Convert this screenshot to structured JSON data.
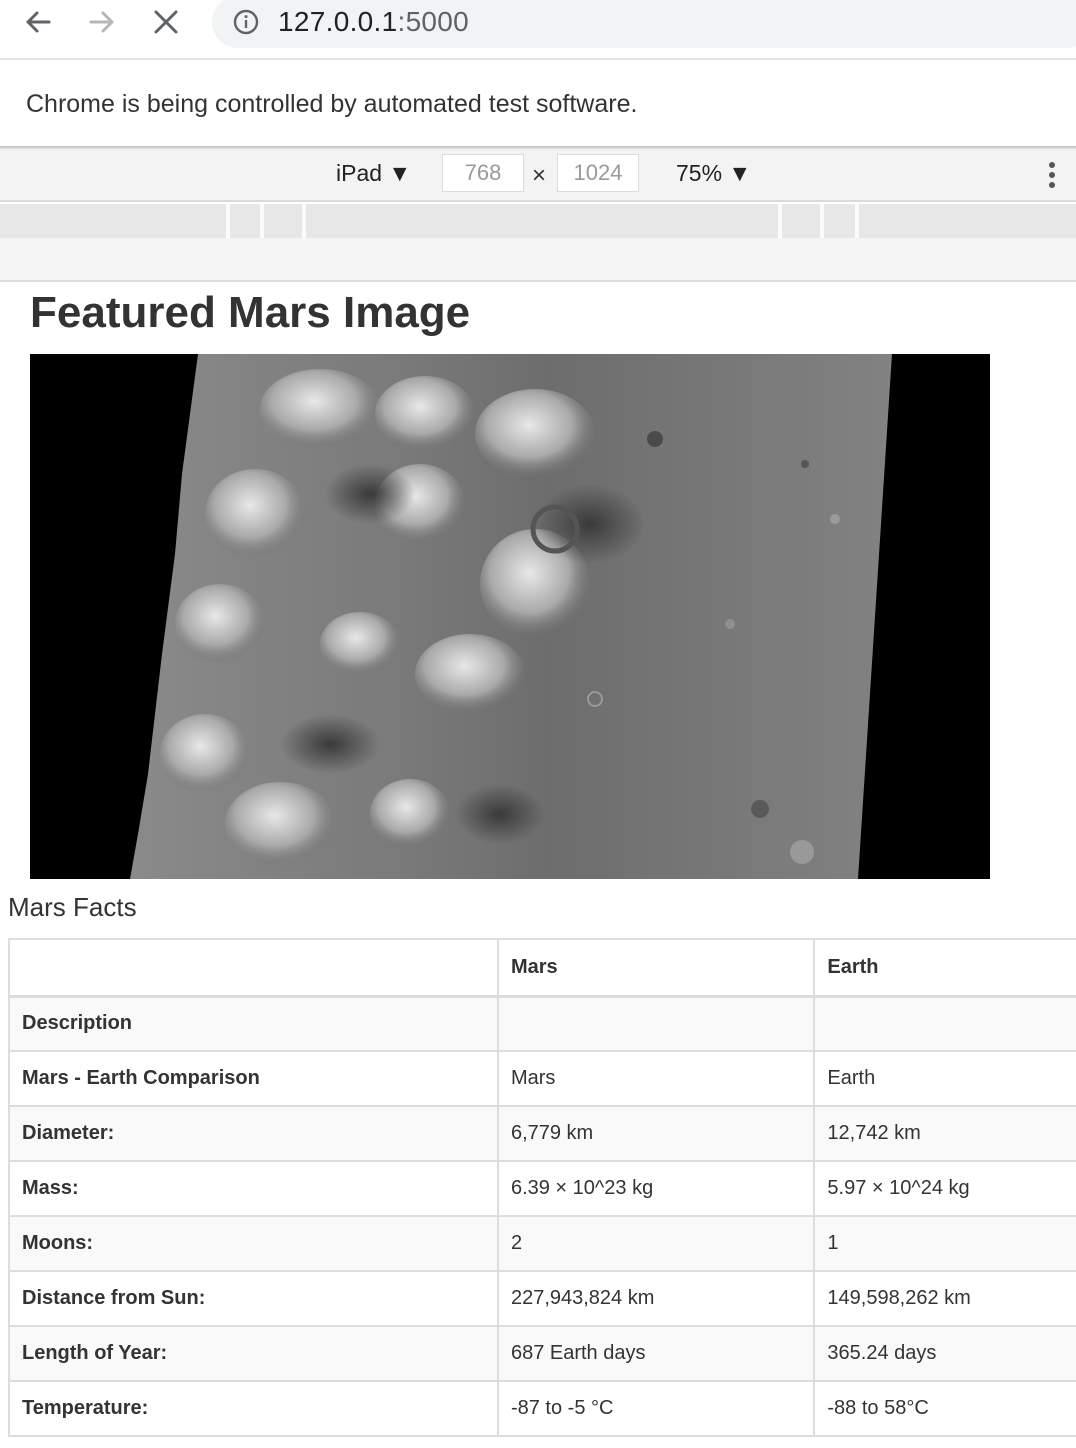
{
  "browser": {
    "url_host": "127.0.0.1",
    "url_port": ":5000",
    "infobar_text": "Chrome is being controlled by automated test software."
  },
  "device_toolbar": {
    "device": "iPad ▼",
    "width": "768",
    "times": "×",
    "height": "1024",
    "zoom": "75% ▼"
  },
  "page": {
    "title": "Featured Mars Image",
    "facts_title": "Mars Facts",
    "table": {
      "headers": [
        "",
        "Mars",
        "Earth"
      ],
      "rows": [
        [
          "Description",
          "",
          ""
        ],
        [
          "Mars - Earth Comparison",
          "Mars",
          "Earth"
        ],
        [
          "Diameter:",
          "6,779 km",
          "12,742 km"
        ],
        [
          "Mass:",
          "6.39 × 10^23 kg",
          "5.97 × 10^24 kg"
        ],
        [
          "Moons:",
          "2",
          "1"
        ],
        [
          "Distance from Sun:",
          "227,943,824 km",
          "149,598,262 km"
        ],
        [
          "Length of Year:",
          "687 Earth days",
          "365.24 days"
        ],
        [
          "Temperature:",
          "-87 to -5 °C",
          "-88 to 58°C"
        ]
      ]
    }
  },
  "icons": {
    "back": "back-arrow-icon",
    "forward": "forward-arrow-icon",
    "stop": "close-icon",
    "info": "info-icon",
    "more": "more-vertical-icon"
  }
}
